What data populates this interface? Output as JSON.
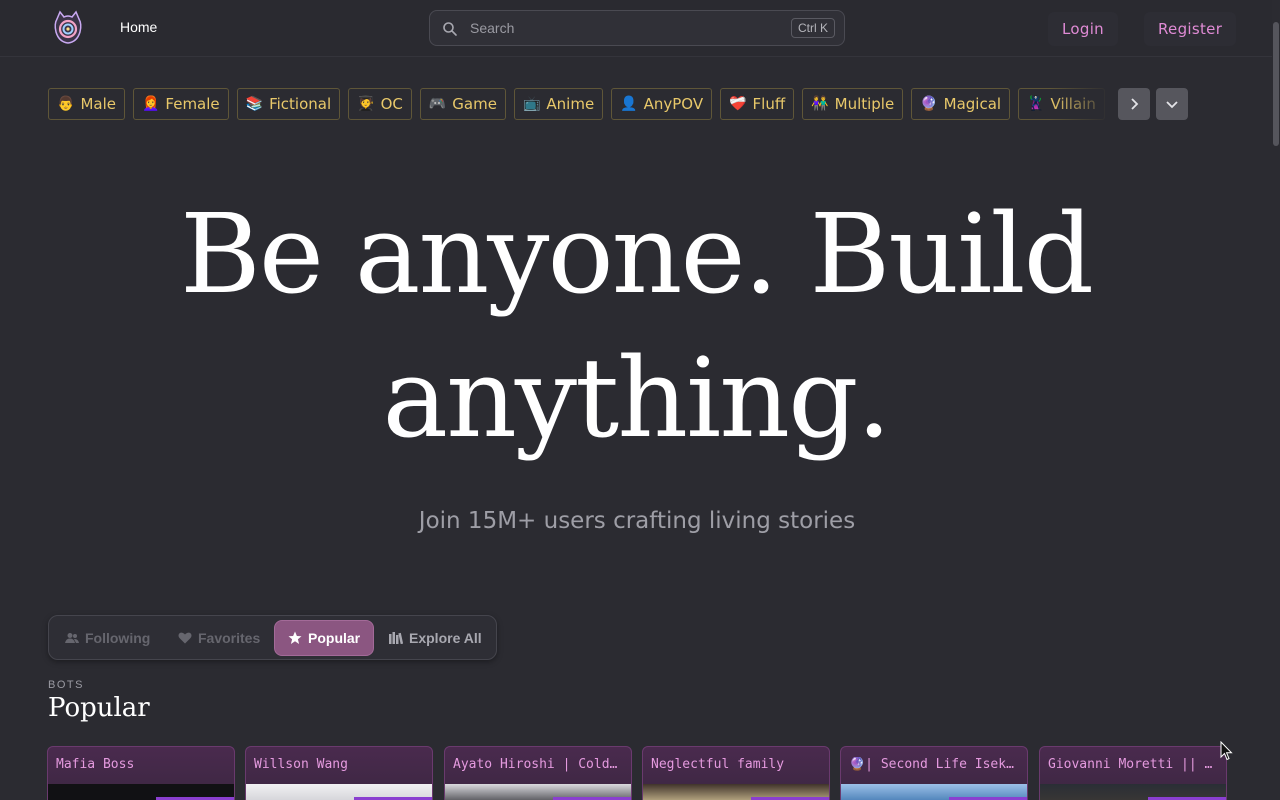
{
  "header": {
    "nav_home": "Home",
    "search": {
      "placeholder": "Search",
      "shortcut": "Ctrl K"
    },
    "login_label": "Login",
    "register_label": "Register"
  },
  "tags": [
    {
      "emoji": "👨",
      "label": "Male"
    },
    {
      "emoji": "👩‍🦰",
      "label": "Female"
    },
    {
      "emoji": "📚",
      "label": "Fictional"
    },
    {
      "emoji": "🧑‍🎓",
      "label": "OC"
    },
    {
      "emoji": "🎮",
      "label": "Game"
    },
    {
      "emoji": "📺",
      "label": "Anime"
    },
    {
      "emoji": "👤",
      "label": "AnyPOV"
    },
    {
      "emoji": "❤️‍🩹",
      "label": "Fluff"
    },
    {
      "emoji": "👫",
      "label": "Multiple"
    },
    {
      "emoji": "🔮",
      "label": "Magical"
    },
    {
      "emoji": "🦹",
      "label": "Villain"
    }
  ],
  "hero": {
    "line1": "Be anyone. Build",
    "line2": "anything.",
    "subtitle": "Join 15M+ users crafting living stories"
  },
  "tabs": [
    {
      "label": "Following",
      "active": false
    },
    {
      "label": "Favorites",
      "active": false
    },
    {
      "label": "Popular",
      "active": true
    },
    {
      "label": "Explore All",
      "active": false
    }
  ],
  "section": {
    "kicker": "BOTS",
    "title": "Popular"
  },
  "cards": [
    {
      "title": "Mafia Boss"
    },
    {
      "title": "Willson Wang"
    },
    {
      "title": "Ayato Hiroshi | Cold Prince"
    },
    {
      "title": "Neglectful family"
    },
    {
      "title": "🔮| Second Life Isekai |🔮"
    },
    {
      "title": "Giovanni Moretti || Single Dad"
    }
  ],
  "colors": {
    "accent": "#e08bd5",
    "tag_text": "#e8c86a",
    "active_tab": "#8b5681",
    "background": "#2b2b31"
  }
}
